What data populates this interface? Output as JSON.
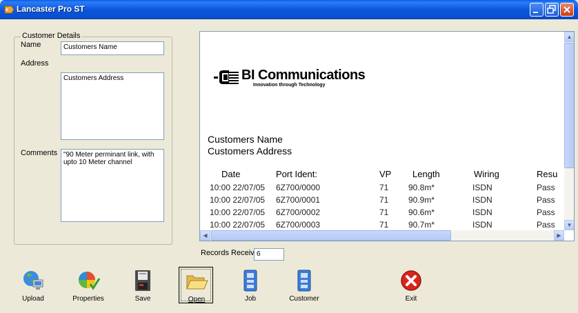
{
  "window": {
    "title": "Lancaster Pro ST"
  },
  "customer_details": {
    "legend": "Customer Details",
    "name_label": "Name",
    "name_value": "Customers Name",
    "address_label": "Address",
    "address_value": "Customers Address",
    "comments_label": "Comments",
    "comments_value": "\"90 Meter perminant link, with upto 10 Meter channel"
  },
  "report": {
    "logo_name": "BI Communications",
    "logo_tagline": "Innovation through Technology",
    "customer_name": "Customers Name",
    "customer_address": "Customers Address",
    "columns": [
      "Date",
      "Port Ident:",
      "VP",
      "Length",
      "Wiring",
      "Resu"
    ],
    "rows": [
      [
        "10:00 22/07/05",
        "6Z700/0000",
        "71",
        "90.8m*",
        "ISDN",
        "Pass"
      ],
      [
        "10:00 22/07/05",
        "6Z700/0001",
        "71",
        "90.9m*",
        "ISDN",
        "Pass"
      ],
      [
        "10:00 22/07/05",
        "6Z700/0002",
        "71",
        "90.6m*",
        "ISDN",
        "Pass"
      ],
      [
        "10:00 22/07/05",
        "6Z700/0003",
        "71",
        "90.7m*",
        "ISDN",
        "Pass"
      ]
    ]
  },
  "records": {
    "label": "Records Received",
    "value": "6"
  },
  "toolbar": {
    "upload": "Upload",
    "properties": "Properties",
    "save": "Save",
    "open": "Open",
    "job": "Job",
    "customer": "Customer",
    "exit": "Exit"
  },
  "colors": {
    "titlebar": "#0A4FD0",
    "window_bg": "#ECE9D8",
    "close_button": "#C93D1A"
  }
}
